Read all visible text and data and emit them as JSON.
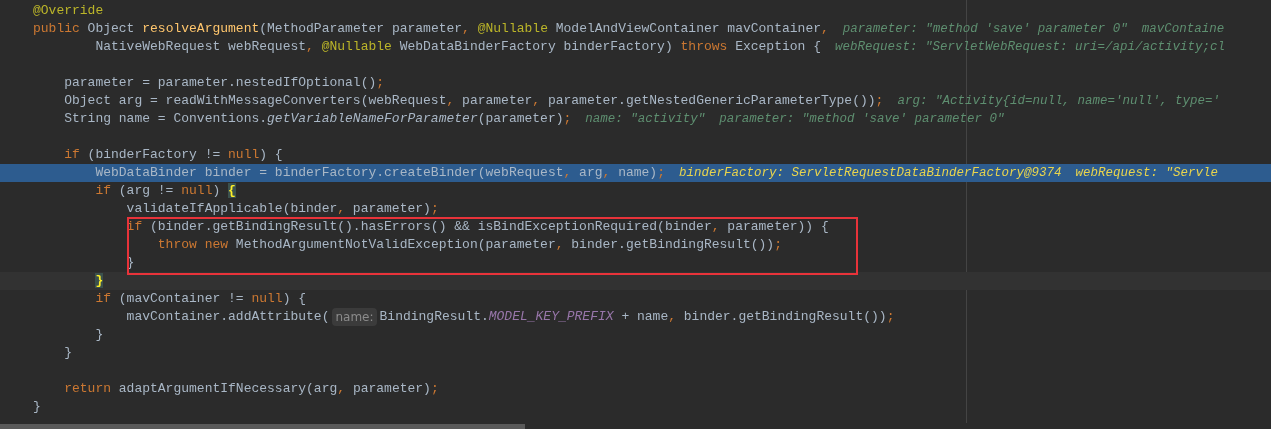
{
  "editor": {
    "lines": [
      {
        "execution_point": false,
        "caret_line": false,
        "boxed": false,
        "segments": [
          {
            "kind": "code",
            "tokens": [
              {
                "kind": "annotation",
                "text": "@Override"
              }
            ]
          }
        ]
      },
      {
        "execution_point": false,
        "caret_line": false,
        "boxed": false,
        "segments": [
          {
            "kind": "code",
            "tokens": [
              {
                "kind": "keyword",
                "text": "public"
              },
              {
                "kind": "plain",
                "text": " Object "
              },
              {
                "kind": "method_decl",
                "text": "resolveArgument"
              },
              {
                "kind": "plain",
                "text": "(MethodParameter parameter"
              },
              {
                "kind": "keyword",
                "text": ", "
              },
              {
                "kind": "annotation",
                "text": "@Nullable"
              },
              {
                "kind": "plain",
                "text": " ModelAndViewContainer mavContainer"
              },
              {
                "kind": "keyword",
                "text": ","
              }
            ]
          },
          {
            "kind": "debug_value",
            "text": "parameter: \"method 'save' parameter 0\""
          },
          {
            "kind": "debug_value",
            "text": "mavContaine"
          }
        ]
      },
      {
        "execution_point": false,
        "caret_line": false,
        "boxed": false,
        "segments": [
          {
            "kind": "code",
            "tokens": [
              {
                "kind": "plain",
                "text": "        NativeWebRequest webRequest"
              },
              {
                "kind": "keyword",
                "text": ", "
              },
              {
                "kind": "annotation",
                "text": "@Nullable"
              },
              {
                "kind": "plain",
                "text": " WebDataBinderFactory binderFactory) "
              },
              {
                "kind": "keyword",
                "text": "throws"
              },
              {
                "kind": "plain",
                "text": " Exception {"
              }
            ]
          },
          {
            "kind": "debug_value",
            "text": "webRequest: \"ServletWebRequest: uri=/api/activity;cl"
          }
        ]
      },
      {
        "execution_point": false,
        "caret_line": false,
        "boxed": false
      },
      {
        "execution_point": false,
        "caret_line": false,
        "boxed": false,
        "segments": [
          {
            "kind": "code",
            "tokens": [
              {
                "kind": "plain",
                "text": "    parameter = parameter.nestedIfOptional()"
              },
              {
                "kind": "keyword",
                "text": ";"
              }
            ]
          }
        ]
      },
      {
        "execution_point": false,
        "caret_line": false,
        "boxed": false,
        "segments": [
          {
            "kind": "code",
            "tokens": [
              {
                "kind": "plain",
                "text": "    Object arg = readWithMessageConverters(webRequest"
              },
              {
                "kind": "keyword",
                "text": ", "
              },
              {
                "kind": "plain",
                "text": "parameter"
              },
              {
                "kind": "keyword",
                "text": ", "
              },
              {
                "kind": "plain",
                "text": "parameter.getNestedGenericParameterType())"
              },
              {
                "kind": "keyword",
                "text": ";"
              }
            ]
          },
          {
            "kind": "debug_value",
            "text": "arg: \"Activity{id=null, name='null', type='"
          }
        ]
      },
      {
        "execution_point": false,
        "caret_line": false,
        "boxed": false,
        "segments": [
          {
            "kind": "code",
            "tokens": [
              {
                "kind": "plain",
                "text": "    String name = Conventions."
              },
              {
                "kind": "static_call",
                "text": "getVariableNameForParameter"
              },
              {
                "kind": "plain",
                "text": "(parameter)"
              },
              {
                "kind": "keyword",
                "text": ";"
              }
            ]
          },
          {
            "kind": "debug_value",
            "text": "name: \"activity\""
          },
          {
            "kind": "debug_value",
            "text": "parameter: \"method 'save' parameter 0\""
          }
        ]
      },
      {
        "execution_point": false,
        "caret_line": false,
        "boxed": false
      },
      {
        "execution_point": false,
        "caret_line": false,
        "boxed": false,
        "segments": [
          {
            "kind": "code",
            "tokens": [
              {
                "kind": "keyword",
                "text": "    if"
              },
              {
                "kind": "plain",
                "text": " (binderFactory != "
              },
              {
                "kind": "keyword",
                "text": "null"
              },
              {
                "kind": "plain",
                "text": ") {"
              }
            ]
          }
        ]
      },
      {
        "execution_point": true,
        "caret_line": false,
        "boxed": false,
        "segments": [
          {
            "kind": "code",
            "tokens": [
              {
                "kind": "plain",
                "text": "        WebDataBinder binder = binderFactory.createBinder(webRequest"
              },
              {
                "kind": "keyword",
                "text": ", "
              },
              {
                "kind": "plain",
                "text": "arg"
              },
              {
                "kind": "keyword",
                "text": ", "
              },
              {
                "kind": "plain",
                "text": "name)"
              },
              {
                "kind": "keyword",
                "text": ";"
              }
            ]
          },
          {
            "kind": "debug_value",
            "text": "binderFactory: ServletRequestDataBinderFactory@9374"
          },
          {
            "kind": "debug_value",
            "text": "webRequest: \"Servle"
          }
        ]
      },
      {
        "execution_point": false,
        "caret_line": false,
        "boxed": false,
        "segments": [
          {
            "kind": "code",
            "tokens": [
              {
                "kind": "keyword",
                "text": "        if"
              },
              {
                "kind": "plain",
                "text": " (arg != "
              },
              {
                "kind": "keyword",
                "text": "null"
              },
              {
                "kind": "plain",
                "text": ") "
              },
              {
                "kind": "brace_match",
                "text": "{"
              }
            ]
          }
        ]
      },
      {
        "execution_point": false,
        "caret_line": false,
        "boxed": false,
        "segments": [
          {
            "kind": "code",
            "tokens": [
              {
                "kind": "plain",
                "text": "            validateIfApplicable(binder"
              },
              {
                "kind": "keyword",
                "text": ", "
              },
              {
                "kind": "plain",
                "text": "parameter)"
              },
              {
                "kind": "keyword",
                "text": ";"
              }
            ]
          }
        ]
      },
      {
        "execution_point": false,
        "caret_line": false,
        "boxed": true,
        "segments": [
          {
            "kind": "code",
            "tokens": [
              {
                "kind": "keyword",
                "text": "            if"
              },
              {
                "kind": "plain",
                "text": " (binder.getBindingResult().hasErrors() && isBindExceptionRequired(binder"
              },
              {
                "kind": "keyword",
                "text": ", "
              },
              {
                "kind": "plain",
                "text": "parameter)) {"
              }
            ]
          }
        ]
      },
      {
        "execution_point": false,
        "caret_line": false,
        "boxed": true,
        "segments": [
          {
            "kind": "code",
            "tokens": [
              {
                "kind": "keyword",
                "text": "                throw new"
              },
              {
                "kind": "plain",
                "text": " MethodArgumentNotValidException(parameter"
              },
              {
                "kind": "keyword",
                "text": ", "
              },
              {
                "kind": "plain",
                "text": "binder.getBindingResult())"
              },
              {
                "kind": "keyword",
                "text": ";"
              }
            ]
          }
        ]
      },
      {
        "execution_point": false,
        "caret_line": false,
        "boxed": true,
        "segments": [
          {
            "kind": "code",
            "tokens": [
              {
                "kind": "plain",
                "text": "            }"
              }
            ]
          }
        ]
      },
      {
        "execution_point": false,
        "caret_line": true,
        "boxed": false,
        "segments": [
          {
            "kind": "code",
            "tokens": [
              {
                "kind": "brace_match",
                "text": "        }"
              }
            ]
          }
        ]
      },
      {
        "execution_point": false,
        "caret_line": false,
        "boxed": false,
        "segments": [
          {
            "kind": "code",
            "tokens": [
              {
                "kind": "keyword",
                "text": "        if"
              },
              {
                "kind": "plain",
                "text": " (mavContainer != "
              },
              {
                "kind": "keyword",
                "text": "null"
              },
              {
                "kind": "plain",
                "text": ") {"
              }
            ]
          }
        ]
      },
      {
        "execution_point": false,
        "caret_line": false,
        "boxed": false,
        "segments": [
          {
            "kind": "code",
            "tokens": [
              {
                "kind": "plain",
                "text": "            mavContainer.addAttribute("
              }
            ]
          },
          {
            "kind": "param_hint",
            "text": "name:"
          },
          {
            "kind": "code",
            "tokens": [
              {
                "kind": "plain",
                "text": "BindingResult."
              },
              {
                "kind": "constant",
                "text": "MODEL_KEY_PREFIX"
              },
              {
                "kind": "plain",
                "text": " + name"
              },
              {
                "kind": "keyword",
                "text": ", "
              },
              {
                "kind": "plain",
                "text": "binder.getBindingResult())"
              },
              {
                "kind": "keyword",
                "text": ";"
              }
            ]
          }
        ]
      },
      {
        "execution_point": false,
        "caret_line": false,
        "boxed": false,
        "segments": [
          {
            "kind": "code",
            "tokens": [
              {
                "kind": "plain",
                "text": "        }"
              }
            ]
          }
        ]
      },
      {
        "execution_point": false,
        "caret_line": false,
        "boxed": false,
        "segments": [
          {
            "kind": "code",
            "tokens": [
              {
                "kind": "plain",
                "text": "    }"
              }
            ]
          }
        ]
      },
      {
        "execution_point": false,
        "caret_line": false,
        "boxed": false
      },
      {
        "execution_point": false,
        "caret_line": false,
        "boxed": false,
        "segments": [
          {
            "kind": "code",
            "tokens": [
              {
                "kind": "keyword",
                "text": "    return"
              },
              {
                "kind": "plain",
                "text": " adaptArgumentIfNecessary(arg"
              },
              {
                "kind": "keyword",
                "text": ", "
              },
              {
                "kind": "plain",
                "text": "parameter)"
              },
              {
                "kind": "keyword",
                "text": ";"
              }
            ]
          }
        ]
      },
      {
        "execution_point": false,
        "caret_line": false,
        "boxed": false,
        "segments": [
          {
            "kind": "code",
            "tokens": [
              {
                "kind": "plain",
                "text": "}"
              }
            ]
          }
        ]
      }
    ]
  }
}
